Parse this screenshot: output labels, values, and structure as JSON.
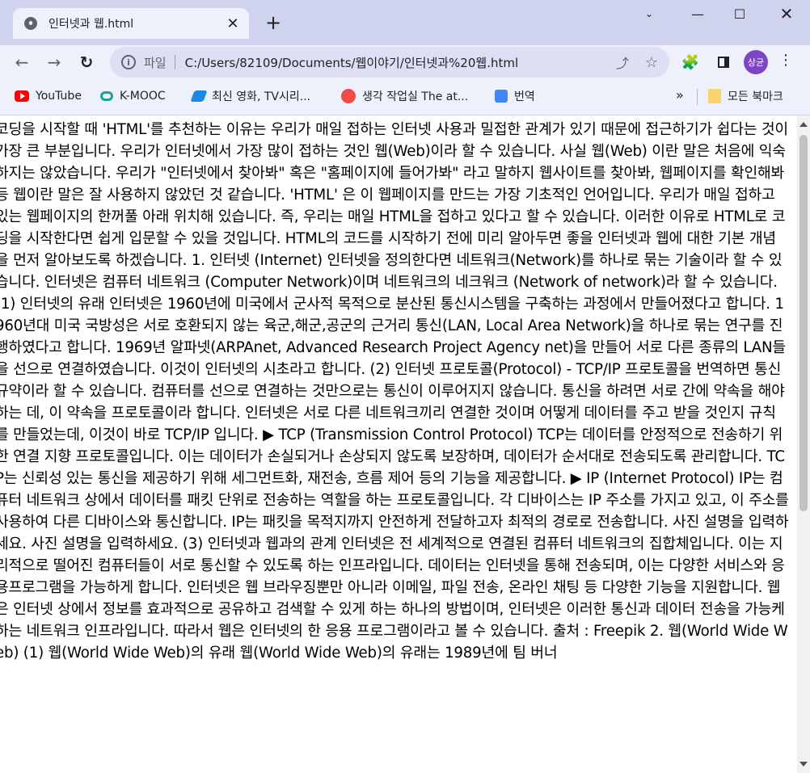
{
  "tab": {
    "title": "인터넷과 웹.html",
    "close": "✕"
  },
  "toolbar": {
    "new_tab": "+",
    "scheme": "파일",
    "url": "C:/Users/82109/Documents/웹이야기/인터넷과%20웹.html",
    "avatar_text": "상균"
  },
  "bookmarks": {
    "items": [
      {
        "label": "YouTube"
      },
      {
        "label": "K-MOOC"
      },
      {
        "label": "최신 영화, TV시리..."
      },
      {
        "label": "생각 작업실 The at..."
      },
      {
        "label": "번역"
      }
    ],
    "more": "»",
    "all_bookmarks": "모든 북마크"
  },
  "content": {
    "text": "코딩을 시작할 때 'HTML'를 추천하는 이유는 우리가 매일 접하는 인터넷 사용과 밀접한 관계가 있기 때문에 접근하기가 쉽다는 것이 가장 큰 부분입니다. 우리가 인터넷에서 가장 많이 접하는 것인 웹(Web)이라 할 수 있습니다. 사실 웹(Web) 이란 말은 처음에 익숙하지는 않았습니다. 우리가 \"인터넷에서 찾아봐\" 혹은 \"홈페이지에 들어가봐\" 라고 말하지 웹사이트를 찾아봐, 웹페이지를 확인해봐 등 웹이란 말은 잘 사용하지 않았던 것 같습니다. 'HTML' 은 이 웹페이지를 만드는 가장 기초적인 언어입니다. 우리가 매일 접하고 있는 웹페이지의 한꺼풀 아래 위치해 있습니다. 즉, 우리는 매일 HTML을 접하고 있다고 할 수 있습니다. 이러한 이유로 HTML로 코딩을 시작한다면 쉽게 입문할 수 있을 것입니다. HTML의 코드를 시작하기 전에 미리 알아두면 좋을 인터넷과 웹에 대한 기본 개념을 먼저 알아보도록 하겠습니다. 1. 인터넷 (Internet) 인터넷을 정의한다면 네트워크(Network)를 하나로 묶는 기술이라 할 수 있습니다. 인터넷은 컴퓨터 네트워크 (Computer Network)이며 네트워크의 네크워크 (Network of network)라 할 수 있습니다. (1) 인터넷의 유래 인터넷은 1960년에 미국에서 군사적 목적으로 분산된 통신시스템을 구축하는 과정에서 만들어졌다고 합니다. 1960년대 미국 국방성은 서로 호환되지 않는 육군,해군,공군의 근거리 통신(LAN, Local Area Network)을 하나로 묶는 연구를 진행하였다고 합니다. 1969년 알파넷(ARPAnet, Advanced Research Project Agency net)을 만들어 서로 다른 종류의 LAN들을 선으로 연결하였습니다. 이것이 인터넷의 시초라고 합니다. (2) 인터넷 프로토콜(Protocol) - TCP/IP 프로토콜을 번역하면 통신규약이라 할 수 있습니다. 컴퓨터를 선으로 연결하는 것만으로는 통신이 이루어지지 않습니다. 통신을 하려면 서로 간에 약속을 해야하는 데, 이 약속을 프로토콜이라 합니다. 인터넷은 서로 다른 네트워크끼리 연결한 것이며 어떻게 데이터를 주고 받을 것인지 규칙를 만들었는데, 이것이 바로 TCP/IP 입니다. ▶ TCP (Transmission Control Protocol) TCP는 데이터를 안정적으로 전송하기 위한 연결 지향 프로토콜입니다. 이는 데이터가 손실되거나 손상되지 않도록 보장하며, 데이터가 순서대로 전송되도록 관리합니다. TCP는 신뢰성 있는 통신을 제공하기 위해 세그먼트화, 재전송, 흐름 제어 등의 기능을 제공합니다. ▶ IP (Internet Protocol) IP는 컴퓨터 네트워크 상에서 데이터를 패킷 단위로 전송하는 역할을 하는 프로토콜입니다. 각 디바이스는 IP 주소를 가지고 있고, 이 주소를 사용하여 다른 디바이스와 통신합니다. IP는 패킷을 목적지까지 안전하게 전달하고자 최적의 경로로 전송합니다. 사진 설명을 입력하세요. 사진 설명을 입력하세요. (3) 인터넷과 웹과의 관계 인터넷은 전 세계적으로 연결된 컴퓨터 네트워크의 집합체입니다. 이는 지리적으로 떨어진 컴퓨터들이 서로 통신할 수 있도록 하는 인프라입니다. 데이터는 인터넷을 통해 전송되며, 이는 다양한 서비스와 응용프로그램을 가능하게 합니다. 인터넷은 웹 브라우징뿐만 아니라 이메일, 파일 전송, 온라인 채팅 등 다양한 기능을 지원합니다. 웹은 인터넷 상에서 정보를 효과적으로 공유하고 검색할 수 있게 하는 하나의 방법이며, 인터넷은 이러한 통신과 데이터 전송을 가능케 하는 네트워크 인프라입니다. 따라서 웹은 인터넷의 한 응용 프로그램이라고 볼 수 있습니다. 출처 : Freepik 2. 웹(World Wide Web) (1) 웹(World Wide Web)의 유래 웹(World Wide Web)의 유래는 1989년에 팀 버너"
  }
}
